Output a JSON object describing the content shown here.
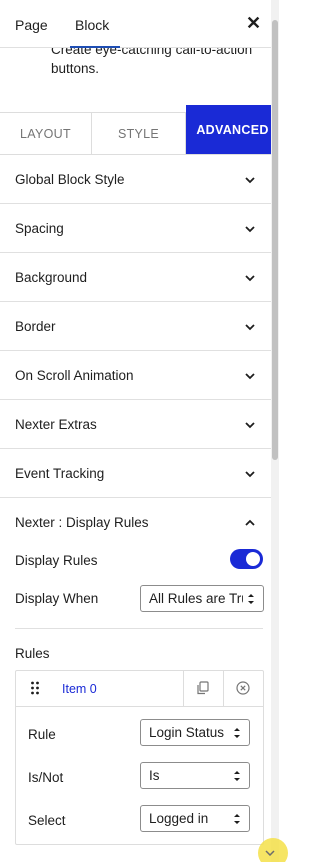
{
  "header": {
    "tabs": [
      {
        "label": "Page",
        "active": false
      },
      {
        "label": "Block",
        "active": true
      }
    ],
    "close_icon": "close-icon"
  },
  "description": "Create eye-catching call-to-action buttons.",
  "subtabs": [
    {
      "label": "LAYOUT",
      "active": false
    },
    {
      "label": "STYLE",
      "active": false
    },
    {
      "label": "ADVANCED",
      "active": true
    }
  ],
  "panels": [
    {
      "title": "Global Block Style",
      "open": false
    },
    {
      "title": "Spacing",
      "open": false
    },
    {
      "title": "Background",
      "open": false
    },
    {
      "title": "Border",
      "open": false
    },
    {
      "title": "On Scroll Animation",
      "open": false
    },
    {
      "title": "Nexter Extras",
      "open": false
    },
    {
      "title": "Event Tracking",
      "open": false
    },
    {
      "title": "Nexter : Display Rules",
      "open": true
    }
  ],
  "display_rules": {
    "toggle_label": "Display Rules",
    "toggle_on": true,
    "display_when_label": "Display When",
    "display_when_value": "All Rules are True",
    "rules_label": "Rules",
    "item": {
      "title": "Item 0",
      "rule_label": "Rule",
      "rule_value": "Login Status",
      "isnot_label": "Is/Not",
      "isnot_value": "Is",
      "select_label": "Select",
      "select_value": "Logged in"
    }
  },
  "colors": {
    "accent": "#1a2ad6",
    "text": "#1e1e1e",
    "border": "#e0e0e0"
  }
}
